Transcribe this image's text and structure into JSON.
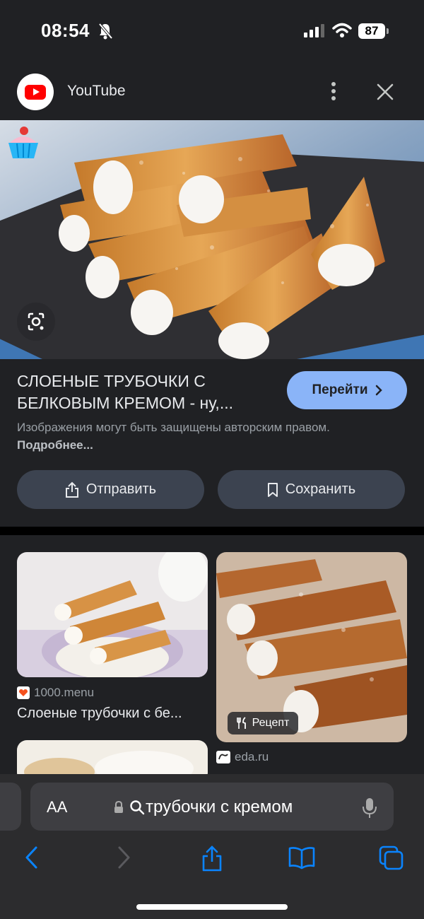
{
  "status_bar": {
    "time": "08:54",
    "battery": "87"
  },
  "source": {
    "name": "YouTube"
  },
  "result": {
    "title": "СЛОЕНЫЕ ТРУБОЧКИ С БЕЛКОВЫМ КРЕМОМ - ну,...",
    "visit_label": "Перейти",
    "copyright_text": "Изображения могут быть защищены авторским правом.",
    "copyright_link": "Подробнее...",
    "share_label": "Отправить",
    "save_label": "Сохранить"
  },
  "related": [
    {
      "source": "1000.menu",
      "title": "Слоеные трубочки с бе..."
    },
    {
      "source": "eda.ru",
      "badge": "Рецепт"
    }
  ],
  "browser": {
    "aa_label": "AA",
    "address": "трубочки с кремом"
  },
  "colors": {
    "accent": "#8ab4f8",
    "background": "#202124",
    "chip": "#3c4350"
  }
}
